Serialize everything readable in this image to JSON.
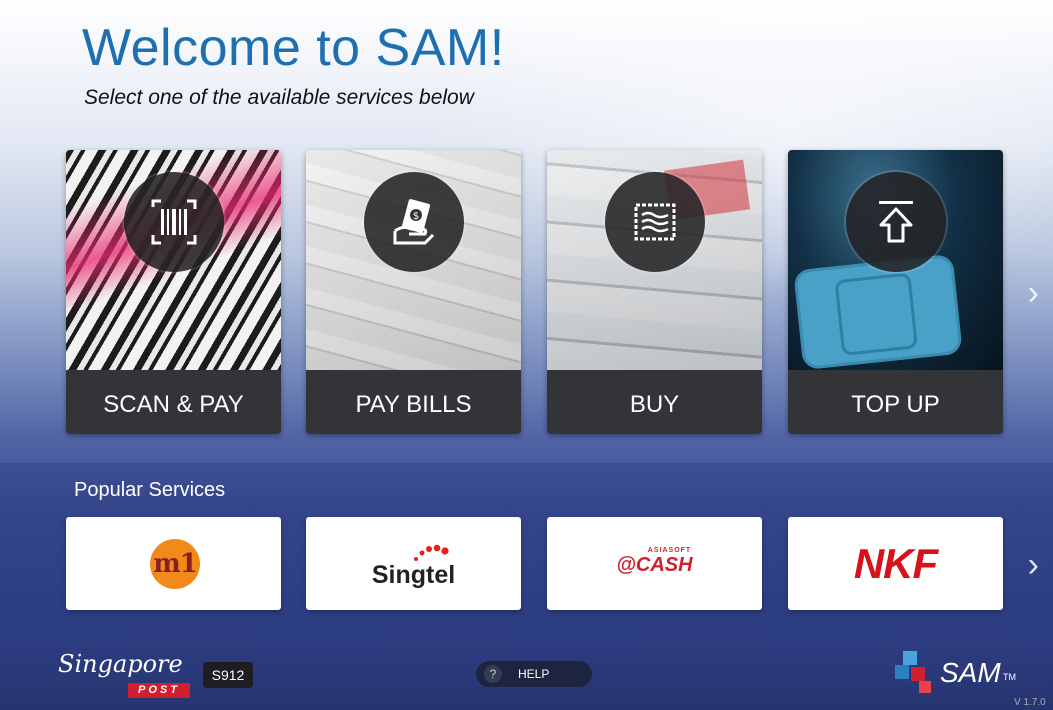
{
  "header": {
    "title": "Welcome to SAM!",
    "subtitle": "Select one of the available services below"
  },
  "services": [
    {
      "label": "SCAN & PAY",
      "icon": "barcode-icon"
    },
    {
      "label": "PAY BILLS",
      "icon": "bill-payment-icon"
    },
    {
      "label": "BUY",
      "icon": "stamp-icon"
    },
    {
      "label": "TOP UP",
      "icon": "upload-arrow-icon"
    }
  ],
  "services_next": "›",
  "popular": {
    "label": "Popular Services",
    "items": [
      {
        "name": "m1",
        "logo_text": "m1",
        "color": "#f28a1b"
      },
      {
        "name": "singtel",
        "logo_text": "Singtel",
        "color": "#e2231a"
      },
      {
        "name": "asiasoft-cash",
        "small_text": "ASIASOFT",
        "logo_text": "@CASH",
        "color": "#d21f2f"
      },
      {
        "name": "nkf",
        "logo_text": "NKF",
        "color": "#d8121b"
      }
    ],
    "next": "›"
  },
  "footer": {
    "brand_script": "Singapore",
    "brand_post": "POST",
    "terminal_code": "S912",
    "help_icon": "?",
    "help_label": "HELP",
    "sam_text": "SAM",
    "sam_tm": "TM",
    "version": "V 1.7.0"
  },
  "colors": {
    "title": "#1e6fb0",
    "caption_bg": "#323437",
    "footer_bg": "#2d3d82",
    "accent_red": "#d21f2f"
  }
}
